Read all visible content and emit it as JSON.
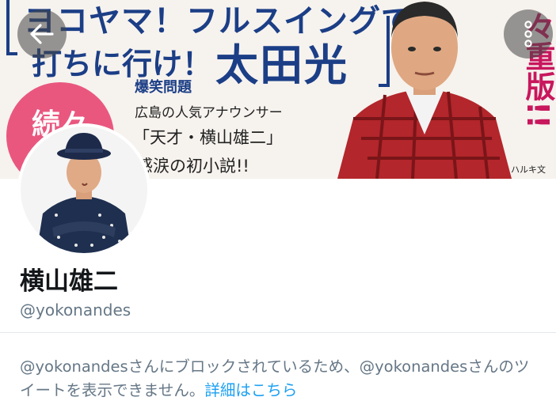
{
  "header": {
    "banner": {
      "headline_1": "ヨコヤマ！フルスイングで",
      "headline_2": "打ちに行け！",
      "comedian_label": "爆笑問題",
      "comedian_name": "太田光",
      "announcer_caption": "広島の人気アナウンサー",
      "genius_line": "「天才・横山雄二」",
      "novel_line": "感涙の初小説!!",
      "badge_text": "続々",
      "reprint_text": "々重版!!",
      "publisher": "ハルキ文"
    },
    "back_icon": "arrow-left-icon",
    "more_icon": "more-vertical-icon"
  },
  "profile": {
    "display_name": "横山雄二",
    "handle": "@yokonandes"
  },
  "notice": {
    "text": "@yokonandesさんにブロックされているため、@yokonandesさんのツイートを表示できません。",
    "link": "詳細はこちら"
  },
  "colors": {
    "accent": "#1da1f2",
    "muted_text": "#657786",
    "name_text": "#14171a",
    "divider": "#e1e8ed",
    "banner_blue": "#1b3e86",
    "banner_pink": "#e9577f"
  }
}
